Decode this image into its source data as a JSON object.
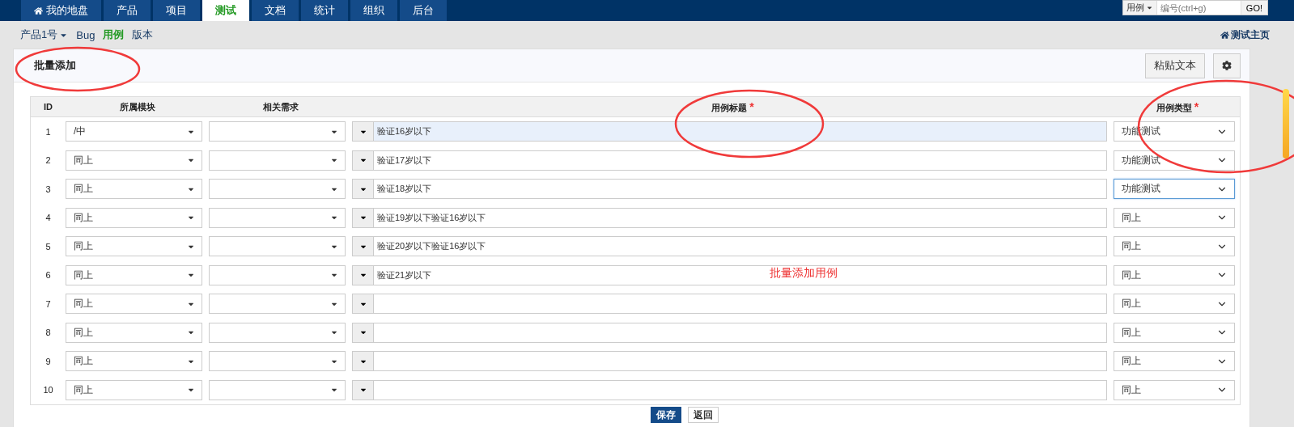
{
  "nav": {
    "tabs": [
      {
        "label": "我的地盘",
        "selected": false
      },
      {
        "label": "产品",
        "selected": false
      },
      {
        "label": "项目",
        "selected": false
      },
      {
        "label": "测试",
        "selected": true
      },
      {
        "label": "文档",
        "selected": false
      },
      {
        "label": "统计",
        "selected": false
      },
      {
        "label": "组织",
        "selected": false
      },
      {
        "label": "后台",
        "selected": false
      }
    ],
    "search": {
      "type_label": "用例",
      "placeholder": "编号(ctrl+g)",
      "button": "GO!"
    }
  },
  "subnav": {
    "product": "产品1号",
    "items": [
      {
        "label": "Bug",
        "selected": false
      },
      {
        "label": "用例",
        "selected": true
      },
      {
        "label": "版本",
        "selected": false
      }
    ],
    "home_link": "测试主页"
  },
  "panel": {
    "title": "批量添加",
    "buttons": [
      "粘贴文本"
    ]
  },
  "table": {
    "columns": [
      {
        "label": "ID"
      },
      {
        "label": "所属模块"
      },
      {
        "label": "相关需求"
      },
      {
        "label": "用例标题",
        "required_mark": "*"
      },
      {
        "label": "用例类型",
        "required_mark": "*"
      }
    ],
    "rows": [
      {
        "id": "1",
        "module": "/中",
        "title": "验证16岁以下",
        "title_focused": true,
        "type": "功能测试",
        "type_focused": false
      },
      {
        "id": "2",
        "module": "同上",
        "title": "验证17岁以下",
        "title_focused": false,
        "type": "功能测试",
        "type_focused": false
      },
      {
        "id": "3",
        "module": "同上",
        "title": "验证18岁以下",
        "title_focused": false,
        "type": "功能测试",
        "type_focused": true
      },
      {
        "id": "4",
        "module": "同上",
        "title": "验证19岁以下验证16岁以下",
        "title_focused": false,
        "type": "同上",
        "type_focused": false
      },
      {
        "id": "5",
        "module": "同上",
        "title": "验证20岁以下验证16岁以下",
        "title_focused": false,
        "type": "同上",
        "type_focused": false
      },
      {
        "id": "6",
        "module": "同上",
        "title": "验证21岁以下",
        "title_focused": false,
        "type": "同上",
        "type_focused": false
      },
      {
        "id": "7",
        "module": "同上",
        "title_focused": false,
        "type": "同上",
        "type_focused": false
      },
      {
        "id": "8",
        "module": "同上",
        "title_focused": false,
        "type": "同上",
        "type_focused": false
      },
      {
        "id": "9",
        "module": "同上",
        "title_focused": false,
        "type": "同上",
        "type_focused": false
      },
      {
        "id": "10",
        "module": "同上",
        "title_focused": false,
        "type": "同上",
        "type_focused": false
      }
    ]
  },
  "annotation_text": "批量添加用例",
  "actions": [
    {
      "label": "保存",
      "kind": "primary"
    },
    {
      "label": "返回",
      "kind": "default"
    }
  ]
}
